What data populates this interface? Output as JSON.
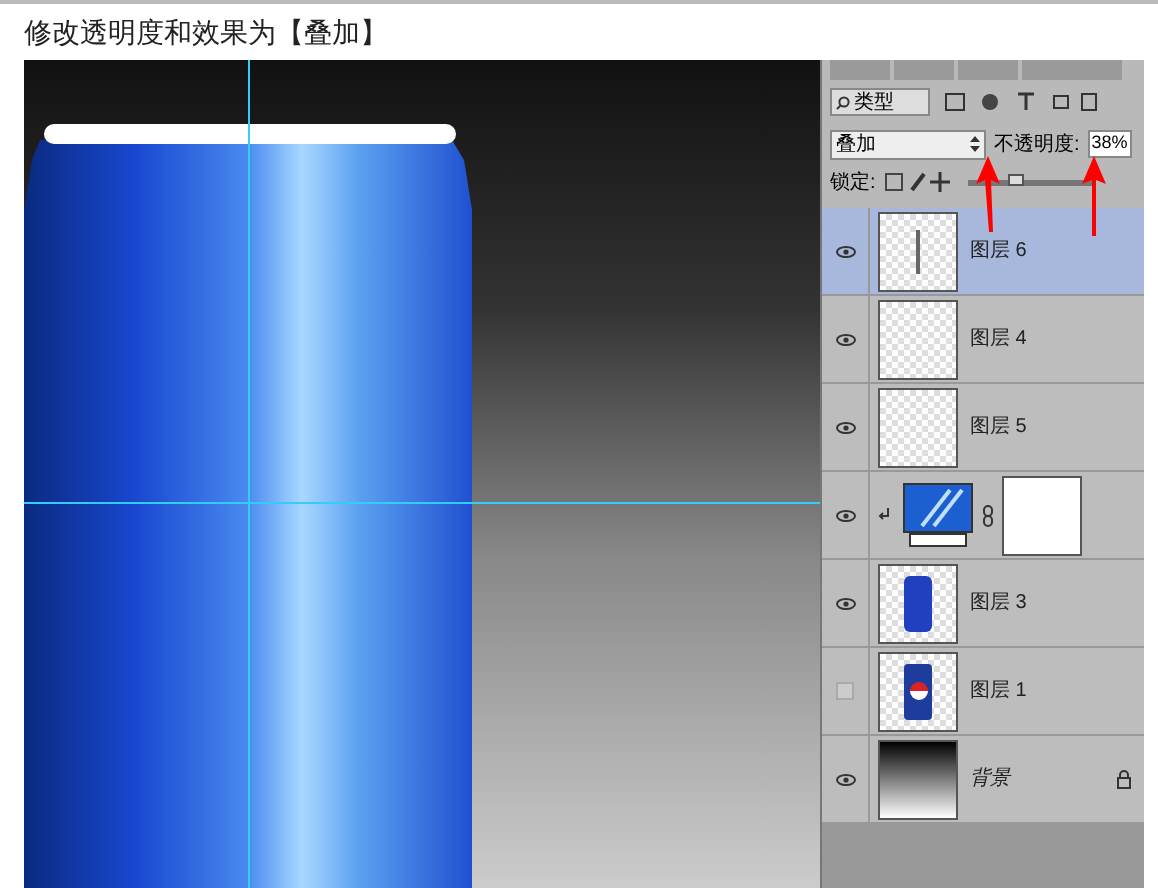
{
  "caption": "修改透明度和效果为【叠加】",
  "panel": {
    "filter": "类型",
    "blend_mode": "叠加",
    "opacity_label": "不透明度:",
    "opacity": "38%",
    "opacity_slider": {
      "level": 0.38
    },
    "lock_label": "锁定:"
  },
  "layers": [
    {
      "name": "图层 6",
      "kind": "stroke",
      "visible": true,
      "selected": true
    },
    {
      "name": "图层 4",
      "kind": "empty",
      "visible": true,
      "selected": false
    },
    {
      "name": "图层 5",
      "kind": "empty",
      "visible": true,
      "selected": false
    },
    {
      "kind": "adjustment",
      "visible": true,
      "selected": false
    },
    {
      "name": "图层 3",
      "kind": "shape",
      "visible": true,
      "selected": false
    },
    {
      "name": "图层 1",
      "kind": "product",
      "visible": false,
      "selected": false
    },
    {
      "name": "背景",
      "kind": "background",
      "visible": true,
      "selected": false,
      "locked": true
    }
  ]
}
